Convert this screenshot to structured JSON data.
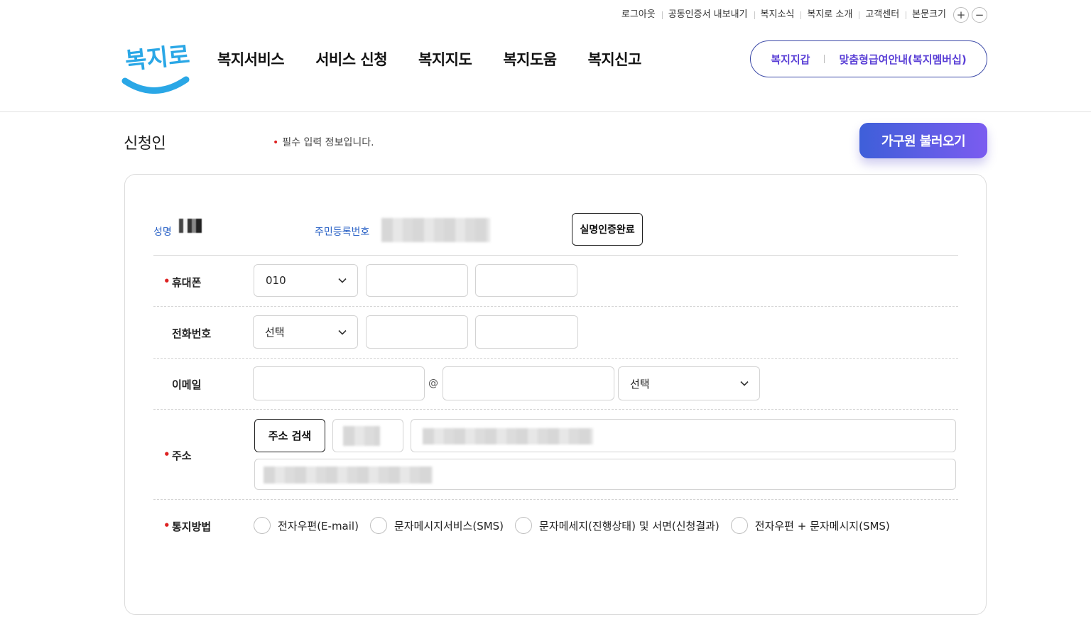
{
  "util_nav": {
    "logout": "로그아웃",
    "cert_export": "공동인증서 내보내기",
    "news": "복지소식",
    "about": "복지로 소개",
    "support": "고객센터",
    "font_size": "본문크기",
    "font_plus": "+",
    "font_minus": "−"
  },
  "logo": {
    "text": "복지로"
  },
  "gnb": {
    "items": [
      "복지서비스",
      "서비스 신청",
      "복지지도",
      "복지도움",
      "복지신고"
    ]
  },
  "quick_links": {
    "wallet": "복지지갑",
    "membership": "맞춤형급여안내(복지멤버십)"
  },
  "section": {
    "title": "신청인",
    "required_note": "필수 입력 정보입니다.",
    "required_mark": "•",
    "load_family_button": "가구원 불러오기"
  },
  "applicant": {
    "name_label": "성명",
    "rrn_label": "주민등록번호",
    "verify_button": "실명인증완료"
  },
  "form": {
    "mobile": {
      "label": "휴대폰",
      "required": true,
      "prefix": "010"
    },
    "phone": {
      "label": "전화번호",
      "required": false,
      "prefix": "선택"
    },
    "email": {
      "label": "이메일",
      "required": false,
      "at": "@",
      "domain_select": "선택"
    },
    "address": {
      "label": "주소",
      "required": true,
      "search_button": "주소 검색"
    },
    "notice": {
      "label": "통지방법",
      "required": true,
      "options": [
        "전자우편(E-mail)",
        "문자메시지서비스(SMS)",
        "문자메세지(진행상태) 및 서면(신청결과)",
        "전자우편 + 문자메시지(SMS)"
      ]
    }
  },
  "colors": {
    "accent_blue": "#2a62c6",
    "required_red": "#dd2222",
    "button_gradient_start": "#3e5fd9",
    "button_gradient_end": "#7b5cf0",
    "quick_text": "#5a3fd6",
    "logo_blue": "#2aa7e6"
  }
}
